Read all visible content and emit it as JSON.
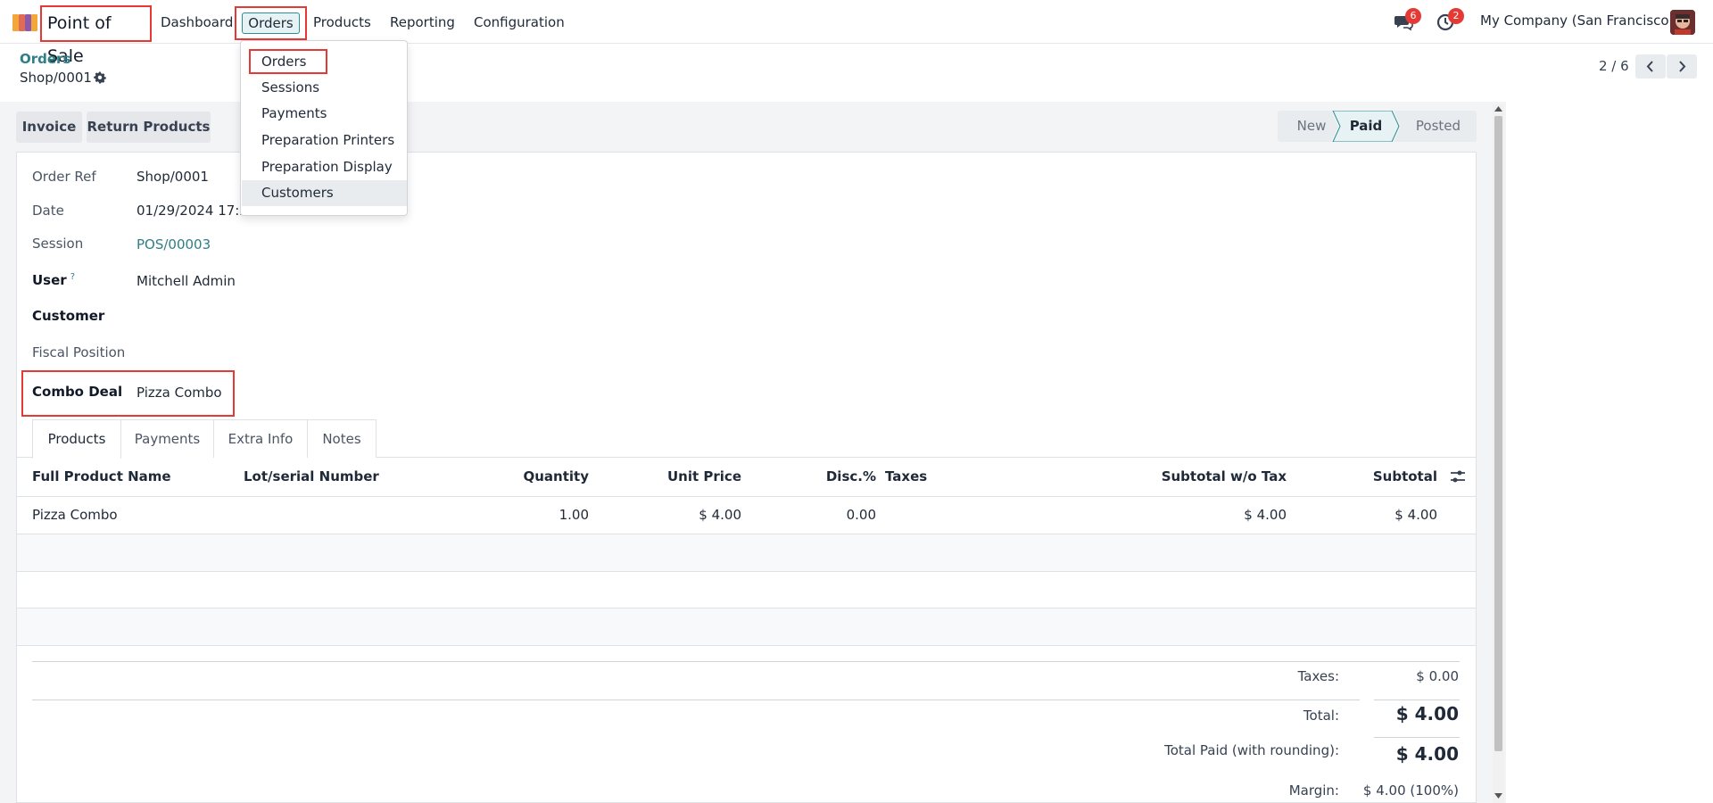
{
  "navbar": {
    "app_title": "Point of Sale",
    "menu": [
      "Dashboard",
      "Orders",
      "Products",
      "Reporting",
      "Configuration"
    ],
    "messages_badge": "6",
    "activities_badge": "2",
    "company": "My Company (San Francisco)"
  },
  "dropdown": {
    "items": [
      "Orders",
      "Sessions",
      "Payments",
      "Preparation Printers",
      "Preparation Display",
      "Customers"
    ]
  },
  "breadcrumb": {
    "parent": "Orders",
    "current": "Shop/0001"
  },
  "pager": {
    "text": "2 / 6"
  },
  "actions": {
    "invoice": "Invoice",
    "return_products": "Return Products"
  },
  "status": {
    "steps": [
      "New",
      "Paid",
      "Posted"
    ],
    "active": "Paid"
  },
  "form": {
    "order_ref_label": "Order Ref",
    "order_ref": "Shop/0001",
    "date_label": "Date",
    "date": "01/29/2024 17:2",
    "session_label": "Session",
    "session": "POS/00003",
    "user_label": "User",
    "user_help": "?",
    "user": "Mitchell Admin",
    "customer_label": "Customer",
    "customer": "",
    "fiscal_label": "Fiscal Position",
    "fiscal": "",
    "combo_label": "Combo Deal",
    "combo": "Pizza Combo"
  },
  "tabs": [
    "Products",
    "Payments",
    "Extra Info",
    "Notes"
  ],
  "table": {
    "headers": [
      "Full Product Name",
      "Lot/serial Number",
      "Quantity",
      "Unit Price",
      "Disc.%",
      "Taxes",
      "Subtotal w/o Tax",
      "Subtotal"
    ],
    "rows": [
      {
        "name": "Pizza Combo",
        "lot": "",
        "qty": "1.00",
        "unit_price": "$ 4.00",
        "disc": "0.00",
        "taxes": "",
        "subtotal_wo_tax": "$ 4.00",
        "subtotal": "$ 4.00"
      }
    ]
  },
  "totals": {
    "taxes_label": "Taxes:",
    "taxes": "$ 0.00",
    "total_label": "Total:",
    "total": "$ 4.00",
    "paid_label": "Total Paid (with rounding):",
    "paid": "$ 4.00",
    "margin_label": "Margin:",
    "margin": "$ 4.00 (100%)"
  },
  "colors": {
    "accent": "#2f7f86",
    "highlight": "#e53935",
    "badge": "#e53935"
  }
}
